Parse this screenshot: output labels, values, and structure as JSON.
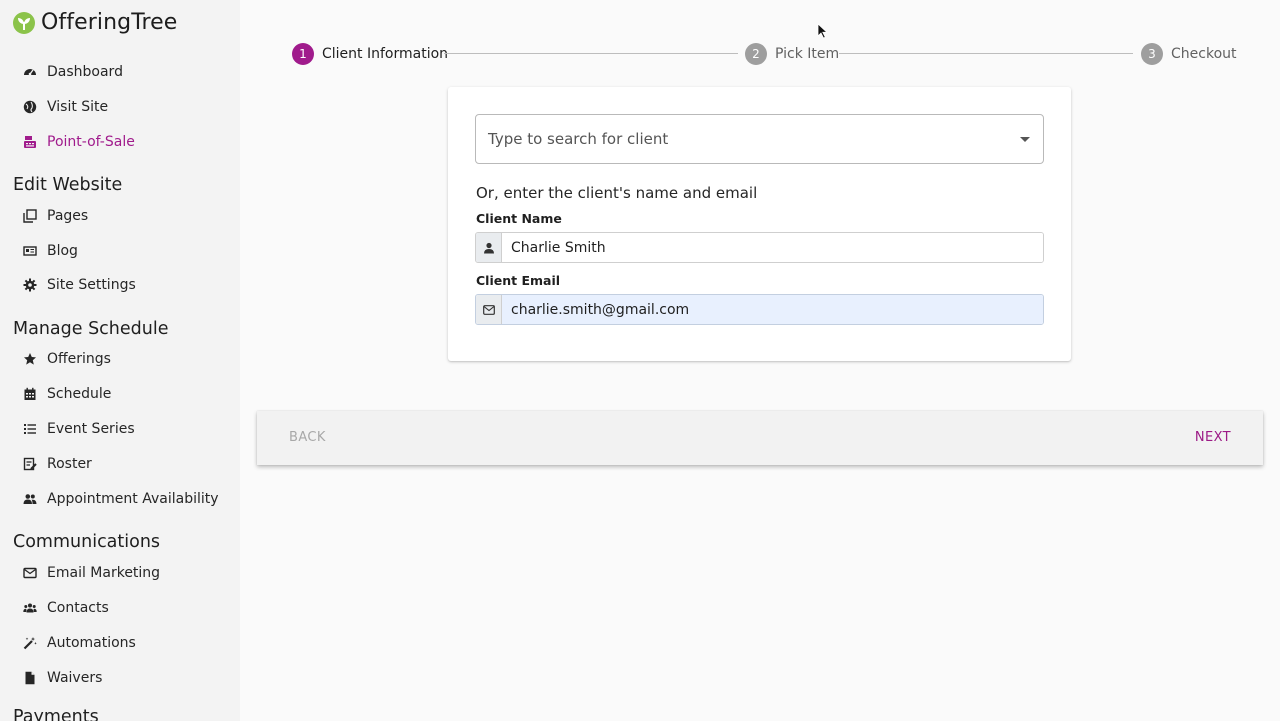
{
  "app": {
    "name": "OfferingTree",
    "brand_color": "#8bc34a",
    "accent": "#a01b8c"
  },
  "sidebar": {
    "items_top": [
      {
        "label": "Dashboard",
        "icon": "dashboard-icon"
      },
      {
        "label": "Visit Site",
        "icon": "globe-icon"
      },
      {
        "label": "Point-of-Sale",
        "icon": "cash-register-icon",
        "active": true
      }
    ],
    "section_edit": "Edit Website",
    "items_edit": [
      {
        "label": "Pages",
        "icon": "pages-icon"
      },
      {
        "label": "Blog",
        "icon": "newspaper-icon"
      },
      {
        "label": "Site Settings",
        "icon": "gear-icon"
      }
    ],
    "section_schedule": "Manage Schedule",
    "items_schedule": [
      {
        "label": "Offerings",
        "icon": "star-icon"
      },
      {
        "label": "Schedule",
        "icon": "calendar-icon"
      },
      {
        "label": "Event Series",
        "icon": "list-icon"
      },
      {
        "label": "Roster",
        "icon": "roster-icon"
      },
      {
        "label": "Appointment Availability",
        "icon": "people-icon"
      }
    ],
    "section_comms": "Communications",
    "items_comms": [
      {
        "label": "Email Marketing",
        "icon": "envelope-icon"
      },
      {
        "label": "Contacts",
        "icon": "contacts-icon"
      },
      {
        "label": "Automations",
        "icon": "magic-wand-icon"
      },
      {
        "label": "Waivers",
        "icon": "file-icon"
      }
    ],
    "section_payments": "Payments"
  },
  "stepper": {
    "steps": [
      {
        "number": "1",
        "label": "Client Information",
        "active": true
      },
      {
        "number": "2",
        "label": "Pick Item",
        "active": false
      },
      {
        "number": "3",
        "label": "Checkout",
        "active": false
      }
    ]
  },
  "form": {
    "search_placeholder": "Type to search for client",
    "or_text": "Or, enter the client's name and email",
    "name_label": "Client Name",
    "name_value": "Charlie Smith",
    "email_label": "Client Email",
    "email_value": "charlie.smith@gmail.com"
  },
  "actions": {
    "back_label": "BACK",
    "next_label": "NEXT"
  }
}
